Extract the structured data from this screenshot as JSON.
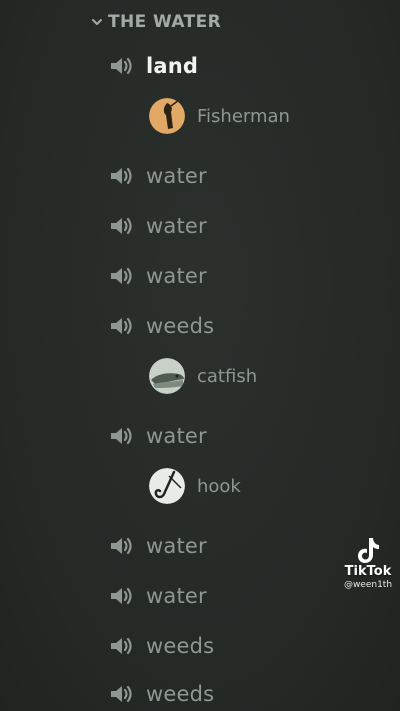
{
  "category": {
    "label": "THE WATER",
    "icon": "chevron-down-icon"
  },
  "channels": [
    {
      "label": "land",
      "icon": "speaker-icon",
      "active": true
    },
    {
      "label": "water",
      "icon": "speaker-icon",
      "active": false
    },
    {
      "label": "water",
      "icon": "speaker-icon",
      "active": false
    },
    {
      "label": "water",
      "icon": "speaker-icon",
      "active": false
    },
    {
      "label": "weeds",
      "icon": "speaker-icon",
      "active": false
    },
    {
      "label": "water",
      "icon": "speaker-icon",
      "active": false
    },
    {
      "label": "water",
      "icon": "speaker-icon",
      "active": false
    },
    {
      "label": "water",
      "icon": "speaker-icon",
      "active": false
    },
    {
      "label": "weeds",
      "icon": "speaker-icon",
      "active": false
    },
    {
      "label": "weeds",
      "icon": "speaker-icon",
      "active": false
    }
  ],
  "users": [
    {
      "name": "Fisherman",
      "avatar": "fisherman-avatar"
    },
    {
      "name": "catfish",
      "avatar": "catfish-avatar"
    },
    {
      "name": "hook",
      "avatar": "hook-avatar"
    }
  ],
  "watermark": {
    "brand": "TikTok",
    "handle": "@ween1th"
  },
  "colors": {
    "background": "#262a27",
    "channel_text": "#8f9791",
    "active_text": "#f2f4f2",
    "category_text": "#a4aaa6"
  }
}
